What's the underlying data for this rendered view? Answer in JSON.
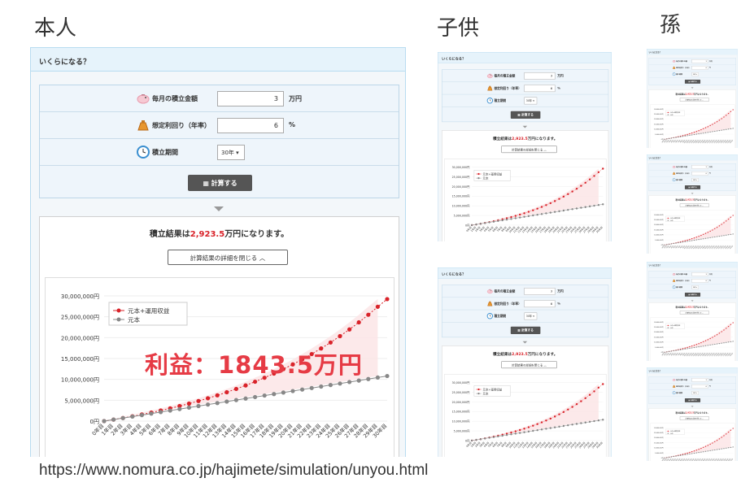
{
  "headings": {
    "self": "本人",
    "child": "子供",
    "grandchild": "孫"
  },
  "url": "https://www.nomura.co.jp/hajimete/simulation/unyou.html",
  "annotation": "利益：1843.5万円",
  "widget": {
    "title": "いくらになる？",
    "monthly_label": "毎月の積立金額",
    "monthly_value": "3",
    "monthly_unit": "万円",
    "rate_label": "想定利回り（年率）",
    "rate_value": "6",
    "rate_unit": "%",
    "period_label": "積立期間",
    "period_value": "30年 ▾",
    "calc_button": "計算する",
    "result_prefix": "積立結果は",
    "result_amount": "2,923.5",
    "result_suffix": "万円になります。",
    "detail_button": "計算結果の詳細を閉じる",
    "chevron": "︿"
  },
  "chart_data": {
    "type": "line",
    "series": [
      {
        "name": "元本+運用収益",
        "color": "#d9232a",
        "values": [
          36,
          74,
          115,
          158,
          204,
          253,
          305,
          360,
          419,
          481,
          547,
          617,
          692,
          771,
          855,
          944,
          1039,
          1139,
          1246,
          1359,
          1479,
          1606,
          1741,
          1884,
          2036,
          2196,
          2367,
          2548,
          2740,
          2923.5
        ]
      },
      {
        "name": "元本",
        "color": "#888888",
        "values": [
          36,
          72,
          108,
          144,
          180,
          216,
          252,
          288,
          324,
          360,
          396,
          432,
          468,
          504,
          540,
          576,
          612,
          648,
          684,
          720,
          756,
          792,
          828,
          864,
          900,
          936,
          972,
          1008,
          1044,
          1080
        ]
      }
    ],
    "x": [
      "0年目",
      "1年目",
      "2年目",
      "3年目",
      "4年目",
      "5年目",
      "6年目",
      "7年目",
      "8年目",
      "9年目",
      "10年目",
      "11年目",
      "12年目",
      "13年目",
      "14年目",
      "15年目",
      "16年目",
      "17年目",
      "18年目",
      "19年目",
      "20年目",
      "21年目",
      "22年目",
      "23年目",
      "24年目",
      "25年目",
      "26年目",
      "27年目",
      "28年目",
      "29年目",
      "30年目"
    ],
    "y_ticks": [
      "0円",
      "5,000,000円",
      "10,000,000円",
      "15,000,000円",
      "20,000,000円",
      "25,000,000円",
      "30,000,000円"
    ],
    "ylim": [
      0,
      3000
    ],
    "legend": "top-left",
    "grid": true
  },
  "colors": {
    "header_bg": "#e6f3fb",
    "accent": "#d9232a",
    "profit": "#e63b45"
  }
}
